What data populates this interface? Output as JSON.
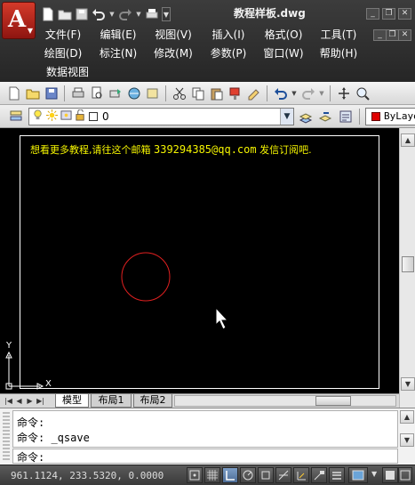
{
  "app": {
    "title": "教程样板.dwg",
    "logo_letter": "A"
  },
  "menus": {
    "row1": [
      "文件(F)",
      "编辑(E)",
      "视图(V)",
      "插入(I)",
      "格式(O)",
      "工具(T)"
    ],
    "row2": [
      "绘图(D)",
      "标注(N)",
      "修改(M)",
      "参数(P)",
      "窗口(W)",
      "帮助(H)"
    ],
    "row3": [
      "数据视图"
    ]
  },
  "layer_toolbar": {
    "current_layer": "0",
    "color_label": "ByLaye",
    "color_hex": "#e00000"
  },
  "drawing": {
    "banner_text": "想看更多教程,请往这个邮箱",
    "banner_email": "339294385@qq.com",
    "banner_tail": "发信订阅吧.",
    "banner_color": "#f5f500",
    "circle_color": "#e02020",
    "ucs_x": "X",
    "ucs_y": "Y"
  },
  "tabs": [
    "模型",
    "布局1",
    "布局2"
  ],
  "command": {
    "history": [
      "命令:",
      "命令: _qsave"
    ],
    "prompt": "命令:"
  },
  "status": {
    "coordinates": "961.1124, 233.5320, 0.0000"
  }
}
